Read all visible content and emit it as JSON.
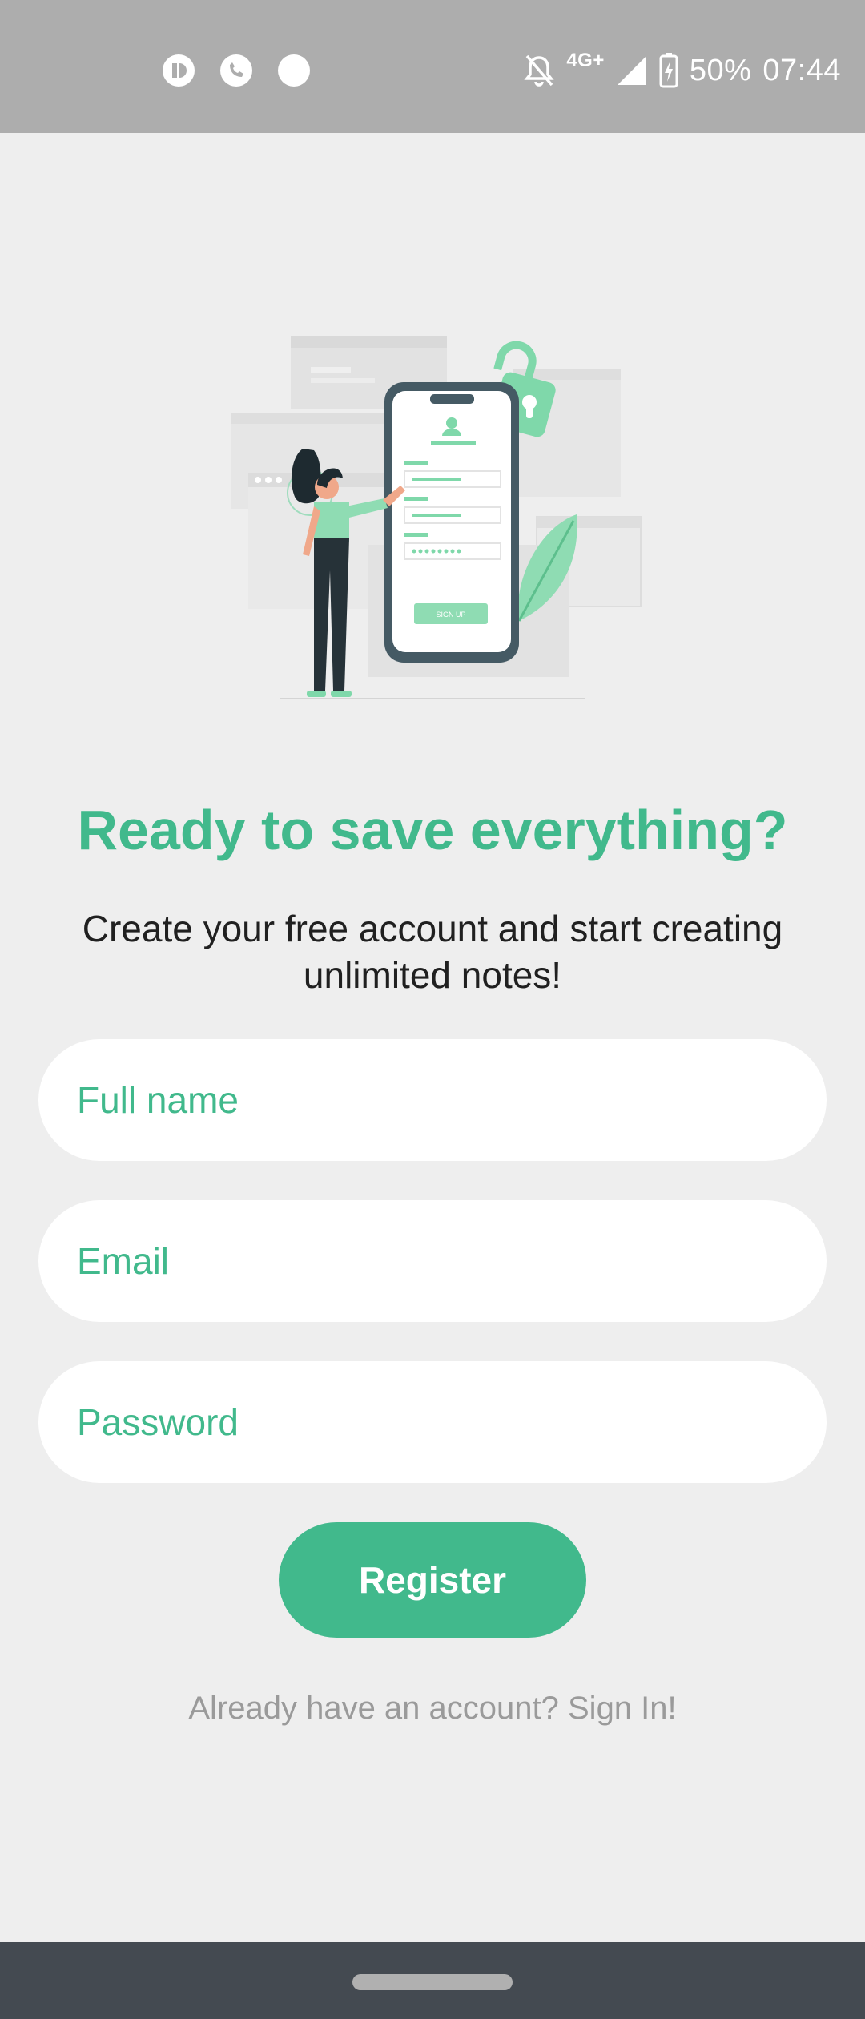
{
  "status_bar": {
    "notification_icons": [
      "app-icon",
      "phone-icon",
      "dot-icon"
    ],
    "system_icons": [
      "bell-off-icon",
      "signal-icon",
      "battery-icon"
    ],
    "network": "4G+",
    "battery": "50%",
    "time": "07:44"
  },
  "colors": {
    "accent": "#41b98c",
    "background": "#eeeeee",
    "status_bar": "#adadad",
    "nav_bar": "#444a51"
  },
  "illustration": {
    "icon": "signup-illustration",
    "button_text": "SIGN UP"
  },
  "headline": "Ready to save everything?",
  "subtitle": "Create your free account and start creating unlimited notes!",
  "form": {
    "full_name_placeholder": "Full name",
    "email_placeholder": "Email",
    "password_placeholder": "Password",
    "register_label": "Register"
  },
  "signin_text": "Already have an account? Sign In!"
}
